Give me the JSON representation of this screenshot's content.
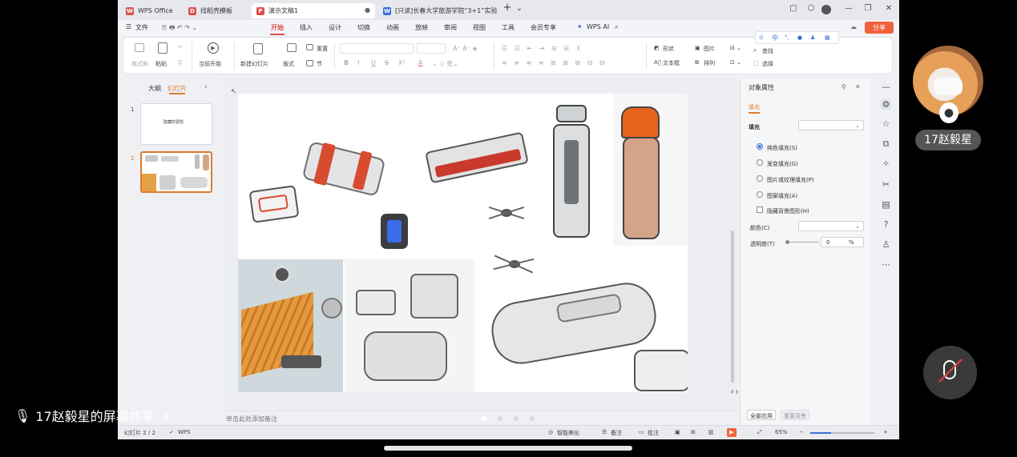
{
  "window": {
    "tabs": [
      {
        "label": "WPS Office",
        "icon": "wps-logo-icon",
        "color": "#d9534f"
      },
      {
        "label": "找稻壳模板",
        "icon": "docer-icon",
        "color": "#e0514b"
      },
      {
        "label": "演示文稿1",
        "icon": "presentation-icon",
        "color": "#e0514b",
        "active": true
      },
      {
        "label": "[只读]长春大学旅游学院“3+1”实验",
        "icon": "word-icon",
        "color": "#3a6fd8"
      }
    ],
    "new_tab_label": "+",
    "tab_menu_label": "⌄"
  },
  "menubar": {
    "file_label": "文件",
    "items": [
      "开始",
      "插入",
      "设计",
      "切换",
      "动画",
      "放映",
      "审阅",
      "视图",
      "工具",
      "会员专享"
    ],
    "active": "开始",
    "wps_ai_label": "WPS AI",
    "share_label": "分享"
  },
  "ribbon": {
    "format_painter": "格式刷",
    "paste": "粘贴",
    "start_from_current": "当前开始",
    "new_slide": "新建幻灯片",
    "layout": "版式",
    "reset": "重置",
    "section": "节",
    "shape": "形状",
    "picture": "图片",
    "textbox": "文本框",
    "arrange": "排列",
    "find": "查找",
    "select": "选择",
    "bold": "B",
    "italic": "I",
    "underline": "U",
    "strikethrough": "S",
    "superscript": "X²",
    "font_color": "A",
    "ime_cn": "中"
  },
  "leftpane": {
    "tab_outline": "大纲",
    "tab_slides": "幻灯片",
    "active_tab": "幻灯片",
    "slides": [
      {
        "number": "1",
        "title": "隐藏的冒险"
      },
      {
        "number": "2",
        "title": ""
      }
    ]
  },
  "notes": {
    "placeholder": "单击此处添加备注"
  },
  "props_panel": {
    "title": "对象属性",
    "section_tab": "填充",
    "fill_label": "填充",
    "options": [
      "纯色填充(S)",
      "渐变填充(G)",
      "图片或纹理填充(P)",
      "图案填充(A)"
    ],
    "selected_option": "纯色填充(S)",
    "hide_bg_label": "隐藏背景图形(H)",
    "color_label": "颜色(C)",
    "transparency_label": "透明度(T)",
    "transparency_value": "0",
    "transparency_unit": "%",
    "apply_all": "全部应用",
    "reset_bg": "重置背景"
  },
  "status": {
    "slide_counter": "幻灯片 2 / 2",
    "wps_label": "WPS",
    "smart_beautify": "智能美化",
    "notes": "备注",
    "comments": "批注",
    "zoom": "65%"
  },
  "meeting": {
    "participant_name": "17赵毅星",
    "share_label": "17赵毅星的屏幕共享",
    "add_label": "+"
  },
  "colors": {
    "accent": "#d9534f",
    "share_btn": "#f0623c",
    "slides_tab": "#e07b2c"
  }
}
